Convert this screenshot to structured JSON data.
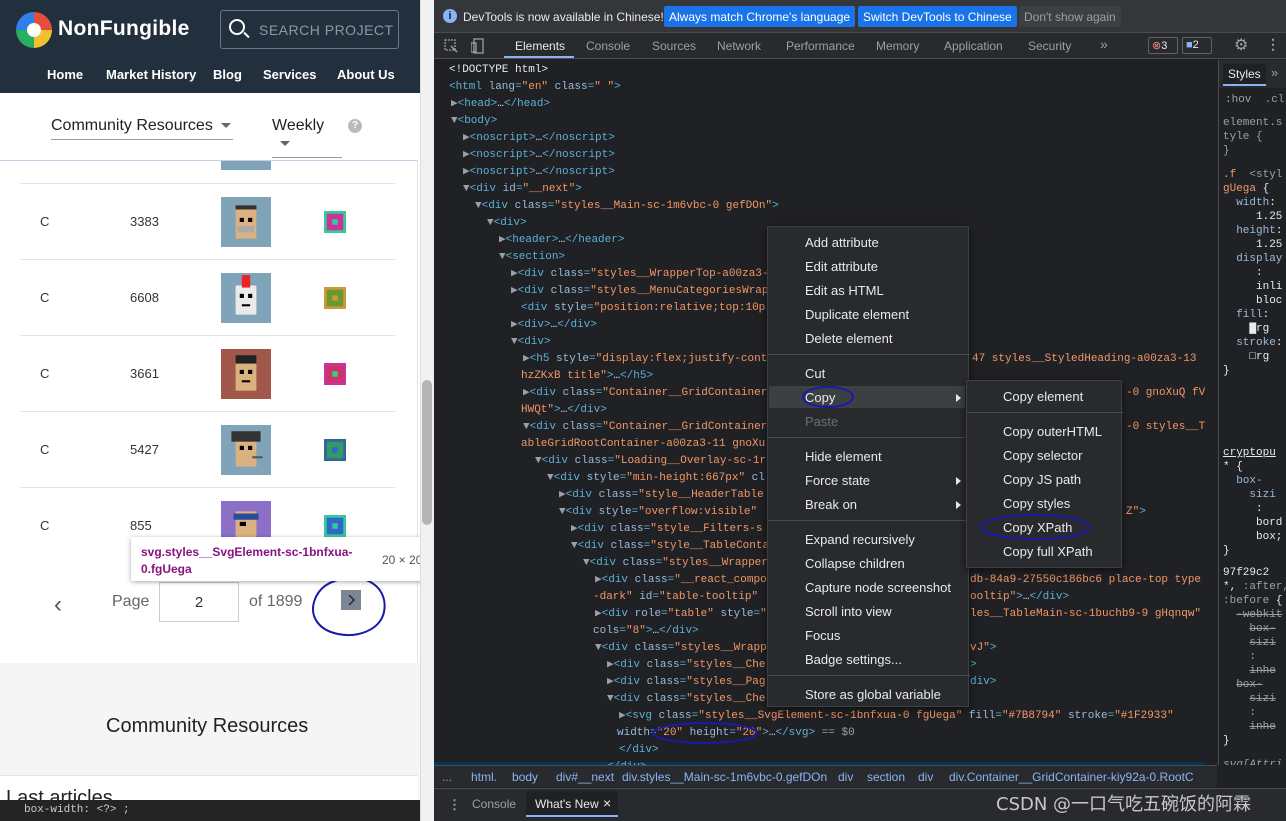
{
  "site": {
    "logo_text": "NonFungible",
    "search_placeholder": "SEARCH PROJECT",
    "nav": [
      "Home",
      "Market History",
      "Blog",
      "Services",
      "About Us"
    ],
    "category_select": "Community Resources",
    "period_select": "Weekly",
    "help_icon": "?",
    "rows": [
      {
        "c": "C",
        "n": "3383"
      },
      {
        "c": "C",
        "n": "6608"
      },
      {
        "c": "C",
        "n": "3661"
      },
      {
        "c": "C",
        "n": "5427"
      },
      {
        "c": "C",
        "n": "855"
      }
    ],
    "tooltip": {
      "name": "svg.styles__SvgElement-sc-1bnfxua-0.fgUega",
      "dims": "20 × 20"
    },
    "pager": {
      "prev": "‹",
      "page_label": "Page",
      "page_value": "2",
      "of_label": "of 1899",
      "next": "›"
    },
    "section_title": "Community Resources",
    "last_articles": "Last articles",
    "bottom_strip": "box-width: <?> ;"
  },
  "devtools": {
    "banner": {
      "text": "DevTools is now available in Chinese!",
      "btn_match": "Always match Chrome's language",
      "btn_switch": "Switch DevTools to Chinese",
      "btn_dismiss": "Don't show again"
    },
    "tabs": [
      "Elements",
      "Console",
      "Sources",
      "Network",
      "Performance",
      "Memory",
      "Application",
      "Security"
    ],
    "more_tabs": "»",
    "errors_count": "3",
    "messages_count": "2",
    "active_tab": "Elements",
    "context_menu": [
      "Add attribute",
      "Edit attribute",
      "Edit as HTML",
      "Duplicate element",
      "Delete element",
      "Cut",
      "Copy",
      "Paste",
      "Hide element",
      "Force state",
      "Break on",
      "Expand recursively",
      "Collapse children",
      "Capture node screenshot",
      "Scroll into view",
      "Focus",
      "Badge settings...",
      "Store as global variable"
    ],
    "copy_submenu": [
      "Copy element",
      "Copy outerHTML",
      "Copy selector",
      "Copy JS path",
      "Copy styles",
      "Copy XPath",
      "Copy full XPath"
    ],
    "breadcrumb": [
      "html.",
      "body",
      "div#__next",
      "div.styles__Main-sc-1m6vbc-0.gefDOn",
      "div",
      "section",
      "div",
      "div.Container__GridContainer-kiy92a-0.RootC"
    ],
    "breadcrumb_more": "...",
    "console_tabs": [
      "Console",
      "What's New"
    ],
    "close_glyph": "×",
    "styles_tabs": [
      "Styles",
      "»"
    ],
    "hov_cls": ":hov  .cl",
    "watermark": "CSDN @一口气吃五碗饭的阿霖",
    "selected_suffix": "== $0",
    "dom_ellipsis": "..."
  }
}
